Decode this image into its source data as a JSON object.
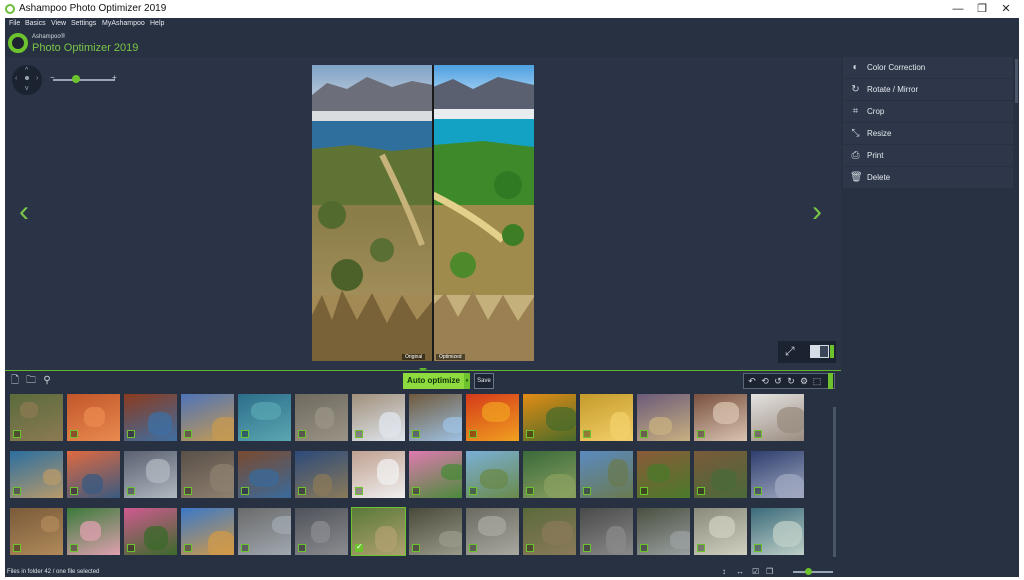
{
  "window": {
    "title": "Ashampoo Photo Optimizer 2019",
    "controls": {
      "minimize": "—",
      "maximize": "❐",
      "close": "✕"
    }
  },
  "menu": [
    "File",
    "Basics",
    "View",
    "Settings",
    "MyAshampoo",
    "Help"
  ],
  "brand": {
    "small": "Ashampoo®",
    "big": "Photo Optimizer 2019"
  },
  "viewer": {
    "nav": {
      "up": "^",
      "down": "v",
      "left": "‹",
      "right": "›"
    },
    "zoom": {
      "minus": "−",
      "plus": "+",
      "level": 0.4
    },
    "labels": {
      "original": "Original",
      "optimized": "Optimized"
    },
    "prev_arrow": "‹",
    "next_arrow": "›",
    "fullscreen_icon": "⤢"
  },
  "side_panel": [
    {
      "label": "Color Correction",
      "icon": "contrast-icon",
      "glyph": "◐"
    },
    {
      "label": "Rotate / Mirror",
      "icon": "rotate-icon",
      "glyph": "↻"
    },
    {
      "label": "Crop",
      "icon": "crop-icon",
      "glyph": "⌗"
    },
    {
      "label": "Resize",
      "icon": "resize-icon",
      "glyph": "⤡"
    },
    {
      "label": "Print",
      "icon": "print-icon",
      "glyph": "⎙"
    },
    {
      "label": "Delete",
      "icon": "trash-icon",
      "glyph": "🗑"
    }
  ],
  "toolbar": {
    "left_tools": [
      {
        "icon": "add-file-icon",
        "glyph": "🗋"
      },
      {
        "icon": "add-folder-icon",
        "glyph": "🗀"
      },
      {
        "icon": "broom-icon",
        "glyph": "⚲"
      }
    ],
    "auto_optimize_label": "Auto optimize",
    "auto_optimize_caret": "▾",
    "save_label": "Save",
    "edit_tools": [
      {
        "icon": "undo-icon",
        "glyph": "↶"
      },
      {
        "icon": "undo-all-icon",
        "glyph": "⟲"
      },
      {
        "icon": "rotate-left-icon",
        "glyph": "↺"
      },
      {
        "icon": "rotate-right-icon",
        "glyph": "↻"
      },
      {
        "icon": "settings-icon",
        "glyph": "⚙"
      },
      {
        "icon": "select-icon",
        "glyph": "⬚"
      }
    ]
  },
  "accent_color": "#6cc32d",
  "background_color": "#283142",
  "thumbnail_rows": 3,
  "thumbnail_cols": 14,
  "selected_thumbnail": 34,
  "status": {
    "text": "Files in folder 42 / one file selected",
    "tools": [
      {
        "icon": "fit-height-icon",
        "glyph": "↕"
      },
      {
        "icon": "fit-width-icon",
        "glyph": "↔"
      },
      {
        "icon": "check-all-icon",
        "glyph": "☑"
      },
      {
        "icon": "copy-icon",
        "glyph": "❐"
      }
    ],
    "thumb_size": 0.35
  }
}
